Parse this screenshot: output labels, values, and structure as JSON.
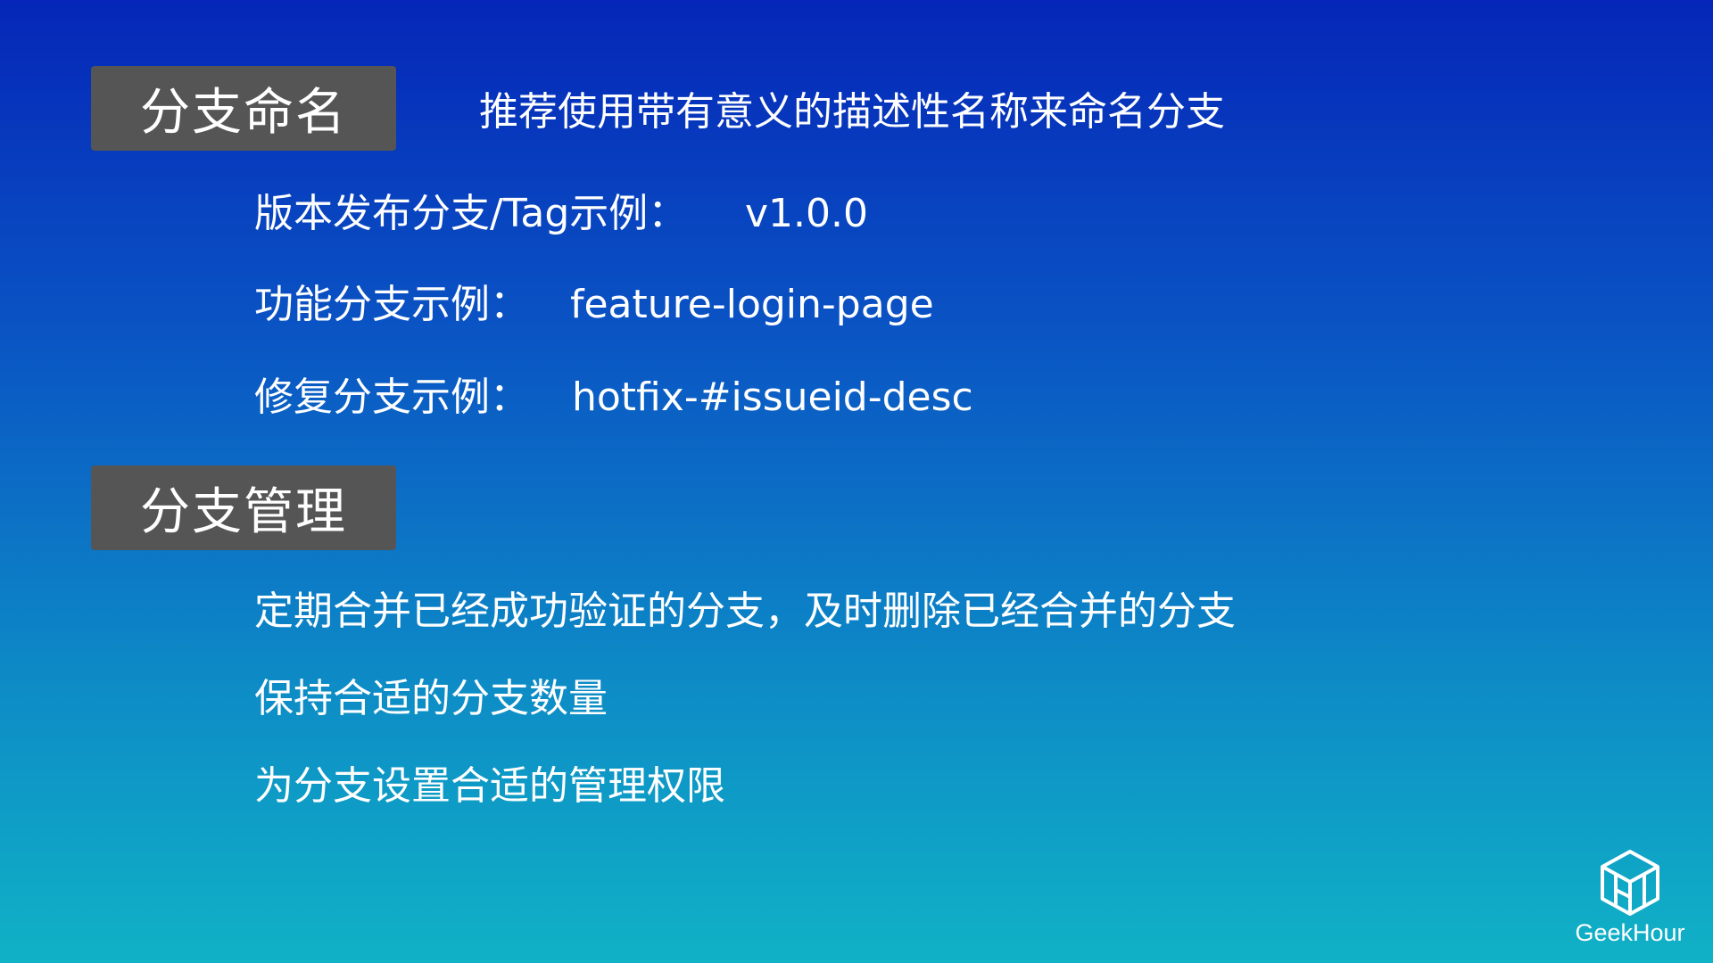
{
  "naming": {
    "tag": "分支命名",
    "subtitle": "推荐使用带有意义的描述性名称来命名分支",
    "items": [
      {
        "label": "版本发布分支/Tag示例：",
        "value": "v1.0.0"
      },
      {
        "label": "功能分支示例：",
        "value": "feature-login-page"
      },
      {
        "label": "修复分支示例：",
        "value": "hotfix-#issueid-desc"
      }
    ]
  },
  "management": {
    "tag": "分支管理",
    "items": [
      "定期合并已经成功验证的分支，及时删除已经合并的分支",
      "保持合适的分支数量",
      "为分支设置合适的管理权限"
    ]
  },
  "brand": {
    "name": "GeekHour",
    "icon": "geekhour-cube-logo-icon"
  }
}
